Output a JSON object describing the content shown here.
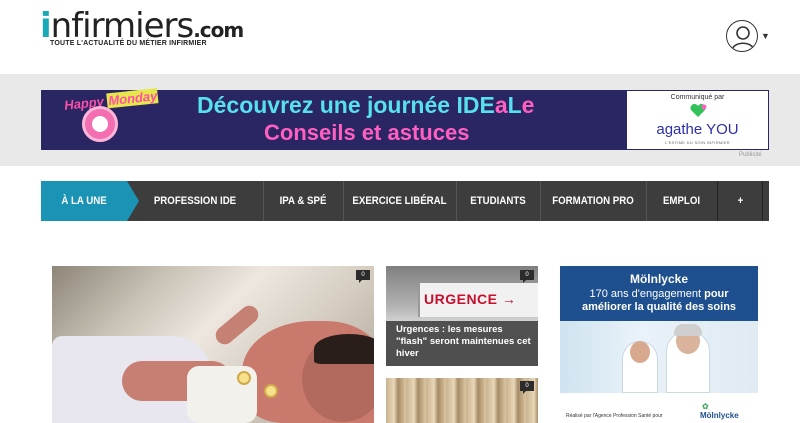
{
  "header": {
    "logo_i": "i",
    "logo_word": "nfirmiers",
    "logo_tld": ".com",
    "tagline": "TOUTE L'ACTUALITÉ DU MÉTIER INFIRMIER",
    "user_icon": "user-avatar-icon",
    "caret_icon": "caret-down-icon"
  },
  "banner_ad": {
    "happy_1": "Happy",
    "happy_2": "Monday",
    "line1_a": "Découvrez une journée ",
    "line1_b": "IDE",
    "line1_c": "a",
    "line1_d": "L",
    "line1_e": "e",
    "line2": "Conseils et astuces",
    "comm": "Communiqué par",
    "brand": "agathe YOU",
    "brand_tag": "L'ESTIME DU SOIN INFIRMIER",
    "pub_label": "Publicité",
    "colors": {
      "bg": "#2a2563",
      "cyan": "#57e0f0",
      "pink": "#ff5fc0"
    }
  },
  "nav": {
    "items": [
      {
        "label": "À LA UNE",
        "active": true
      },
      {
        "label": "PROFESSION IDE"
      },
      {
        "label": "IPA & SPÉ"
      },
      {
        "label": "EXERCICE LIBÉRAL"
      },
      {
        "label": "ETUDIANTS"
      },
      {
        "label": "FORMATION PRO"
      },
      {
        "label": "EMPLOI"
      },
      {
        "label": "+"
      }
    ],
    "search_icon": "search-icon",
    "colors": {
      "bar": "#3d3d3d",
      "active": "#1a93b5"
    }
  },
  "articles": {
    "main": {
      "comments": "0"
    },
    "urgences": {
      "comments": "0",
      "sign": "URGENCE",
      "title": "Urgences : les mesures \"flash\" seront maintenues cet hiver"
    },
    "books": {
      "comments": "0"
    }
  },
  "side_ad": {
    "brand": "Mölnlycke",
    "l1_a": "170 ans d'engagement ",
    "l1_b": "pour",
    "l2": "améliorer la qualité des soins",
    "footer": "Réalisé par l'Agence Profession Santé pour",
    "footer_logo": "Mölnlycke"
  }
}
